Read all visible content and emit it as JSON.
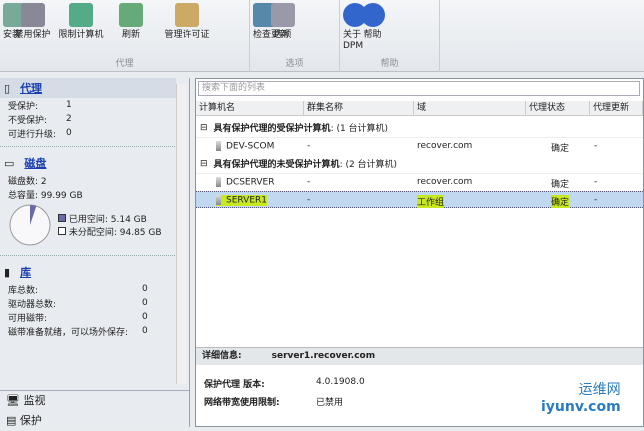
{
  "ribbon": {
    "groups": [
      {
        "label": "代理",
        "buttons": [
          "安装",
          "禁用保护",
          "限制计算机",
          "刷新",
          "管理许可证"
        ]
      },
      {
        "label": "选项",
        "buttons": [
          "检查更新",
          "选项"
        ]
      },
      {
        "label": "帮助",
        "buttons": [
          "关于\nDPM",
          "帮助"
        ]
      }
    ]
  },
  "left": {
    "agents": {
      "title": "代理",
      "items": [
        {
          "k": "受保护:",
          "v": "1"
        },
        {
          "k": "不受保护:",
          "v": "2"
        },
        {
          "k": "可进行升级:",
          "v": "0"
        }
      ]
    },
    "disks": {
      "title": "磁盘",
      "count": "磁盘数: 2",
      "capacity": "总容量: 99.99 GB",
      "used": "已用空间: 5.14 GB",
      "free": "未分配空间: 94.85 GB",
      "used_fraction": 0.0514,
      "used_color": "#6a6aaa"
    },
    "library": {
      "title": "库",
      "items": [
        {
          "k": "库总数:",
          "v": "0"
        },
        {
          "k": "驱动器总数:",
          "v": "0"
        },
        {
          "k": "可用磁带:",
          "v": "0"
        },
        {
          "k": "磁带准备就绪，可以场外保存:",
          "v": "0"
        }
      ]
    },
    "nav": [
      "监视",
      "保护"
    ]
  },
  "list": {
    "search_placeholder": "搜索下面的列表",
    "columns": [
      "计算机名",
      "群集名称",
      "域",
      "代理状态",
      "代理更新"
    ],
    "groups": [
      {
        "title": "具有保护代理的受保护计算机",
        "count": ": (1 台计算机)",
        "rows": [
          [
            "DEV-SCOM",
            "-",
            "recover.com",
            "确定",
            "-"
          ]
        ]
      },
      {
        "title": "具有保护代理的未受保护计算机",
        "count": ": (2 台计算机)",
        "rows": [
          [
            "DCSERVER",
            "-",
            "recover.com",
            "确定",
            "-"
          ],
          [
            "SERVER1",
            "-",
            "工作组",
            "确定",
            "-"
          ]
        ]
      }
    ]
  },
  "detail": {
    "label": "详细信息:",
    "name": "server1.recover.com",
    "items": [
      {
        "k": "保护代理 版本:",
        "v": "4.0.1908.0"
      },
      {
        "k": "网络带宽使用限制:",
        "v": "已禁用"
      }
    ]
  },
  "watermark": {
    "cn": "运维网",
    "en": "iyunv.com"
  }
}
